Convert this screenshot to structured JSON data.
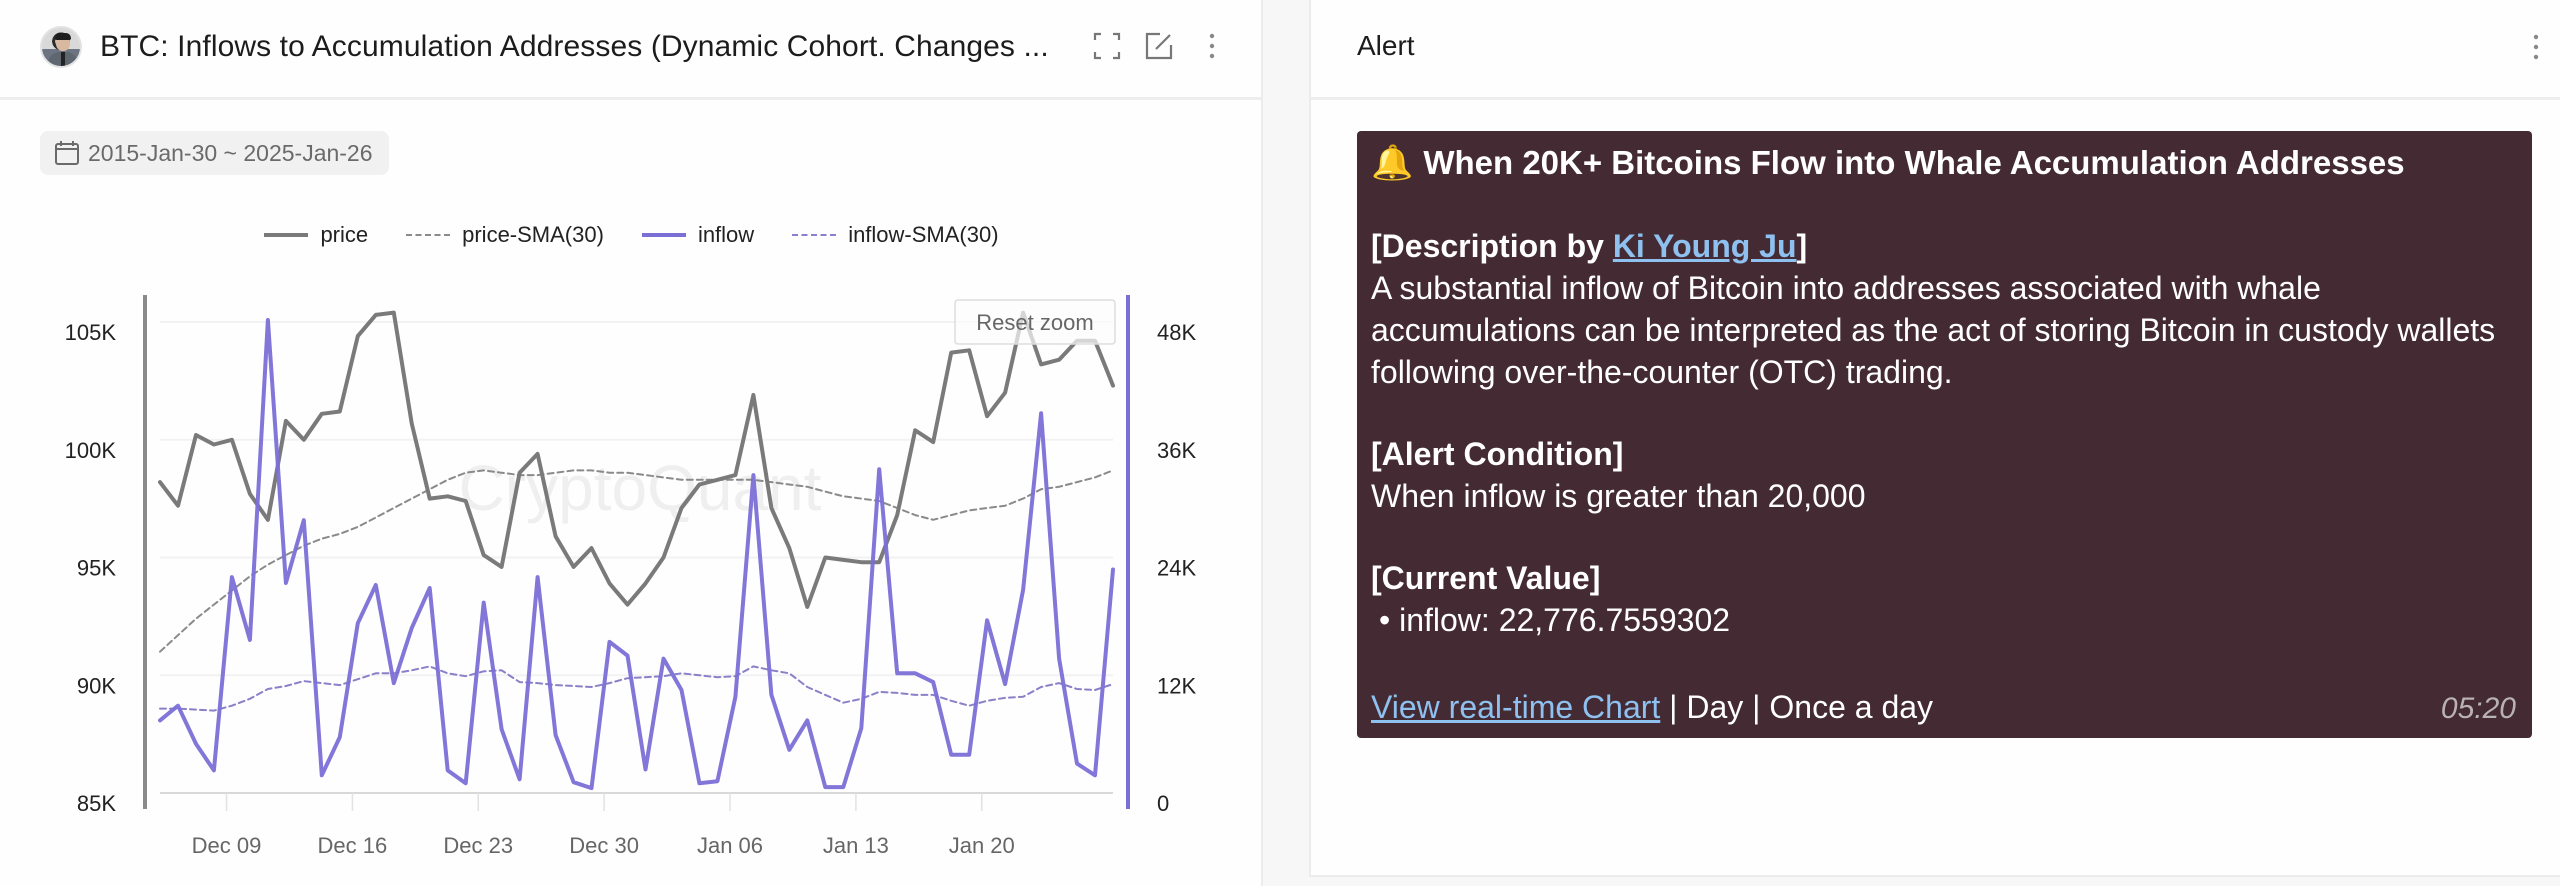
{
  "left_panel": {
    "title": "BTC: Inflows to Accumulation Addresses (Dynamic Cohort. Changes ...",
    "icons": {
      "fullscreen": "fullscreen-icon",
      "open_external": "open-external-icon",
      "more": "more-vertical-icon"
    },
    "date_range": "2015-Jan-30 ~ 2025-Jan-26",
    "reset_zoom_label": "Reset zoom",
    "watermark": "CryptoQuant"
  },
  "right_panel": {
    "title": "Alert",
    "more_icon": "more-vertical-icon",
    "alert": {
      "bell_icon": "🔔",
      "headline": "When 20K+ Bitcoins Flow into Whale Accumulation Addresses",
      "description_prefix": "[Description by ",
      "author_link": "Ki Young Ju",
      "description_suffix": "]",
      "description": "A substantial inflow of Bitcoin into addresses associated with whale accumulations can be interpreted as the act of storing Bitcoin in custody wallets following over-the-counter (OTC) trading.",
      "condition_heading": "[Alert Condition]",
      "condition": "When inflow is greater than 20,000",
      "current_heading": "[Current Value]",
      "current_value": "• inflow: 22,776.7559302",
      "chart_link": "View real-time Chart",
      "sep1": " | ",
      "interval": "Day",
      "sep2": " | ",
      "frequency": "Once a day",
      "time": "05:20"
    }
  },
  "colors": {
    "price": "#7a7a7a",
    "inflow": "#7b6fd6",
    "alert_bg": "#442b33",
    "link": "#8ec0f0"
  },
  "chart_data": {
    "type": "line",
    "title": "BTC: Inflows to Accumulation Addresses (Dynamic Cohort. Changes ...",
    "legend": [
      "price",
      "price-SMA(30)",
      "inflow",
      "inflow-SMA(30)"
    ],
    "legend_position": "top-center",
    "x_start": "2024-12-05",
    "x_interval": "1 day",
    "x_tick_labels": [
      "Dec 09",
      "Dec 16",
      "Dec 23",
      "Dec 30",
      "Jan 06",
      "Jan 13",
      "Jan 20"
    ],
    "x_tick_offsets_days": [
      4,
      11,
      18,
      25,
      32,
      39,
      46
    ],
    "y_left": {
      "label": "price",
      "ticks": [
        "85K",
        "90K",
        "95K",
        "100K",
        "105K"
      ],
      "range": [
        85000,
        105000
      ]
    },
    "y_right": {
      "label": "inflow",
      "ticks": [
        "0",
        "12K",
        "24K",
        "36K",
        "48K"
      ],
      "range": [
        0,
        48000
      ]
    },
    "grid": true,
    "series": [
      {
        "name": "price",
        "axis": "left",
        "style": "solid",
        "values": [
          98200,
          97200,
          100200,
          99800,
          100000,
          97700,
          96600,
          100800,
          100000,
          101100,
          101200,
          104400,
          105300,
          105400,
          100700,
          97500,
          97600,
          97400,
          95100,
          94600,
          98600,
          99400,
          95900,
          94600,
          95400,
          93900,
          93000,
          93900,
          95000,
          97100,
          98100,
          98300,
          98500,
          101900,
          97100,
          95400,
          92900,
          95000,
          94900,
          94800,
          94800,
          96800,
          100400,
          99900,
          103700,
          103800,
          101000,
          102000,
          105400,
          103200,
          103400,
          104200,
          104200,
          102300
        ]
      },
      {
        "name": "price-SMA(30)",
        "axis": "left",
        "style": "dashed",
        "values": [
          91000,
          91700,
          92400,
          93000,
          93600,
          94200,
          94700,
          95100,
          95500,
          95800,
          96000,
          96300,
          96700,
          97100,
          97500,
          97900,
          98300,
          98600,
          98700,
          98600,
          98500,
          98500,
          98600,
          98700,
          98700,
          98600,
          98600,
          98500,
          98400,
          98300,
          98300,
          98300,
          98300,
          98300,
          98200,
          98100,
          98000,
          97800,
          97600,
          97500,
          97400,
          97100,
          96800,
          96600,
          96800,
          97000,
          97100,
          97200,
          97500,
          97900,
          98000,
          98200,
          98400,
          98700
        ]
      },
      {
        "name": "inflow",
        "axis": "right",
        "style": "solid",
        "values": [
          7400,
          8900,
          5000,
          2300,
          22000,
          15600,
          48200,
          21400,
          27800,
          1800,
          5700,
          17300,
          21200,
          11200,
          16800,
          20900,
          2300,
          1000,
          19400,
          6500,
          1400,
          22000,
          5900,
          1100,
          500,
          15400,
          14000,
          2400,
          13700,
          10500,
          1000,
          1200,
          9800,
          32400,
          10000,
          4400,
          7400,
          600,
          600,
          6600,
          33000,
          12200,
          12200,
          11300,
          3900,
          3900,
          17600,
          11100,
          20700,
          38700,
          13700,
          3000,
          1800,
          22777
        ]
      },
      {
        "name": "inflow-SMA(30)",
        "axis": "right",
        "style": "dashed",
        "values": [
          8600,
          8600,
          8500,
          8400,
          8900,
          9600,
          10600,
          10900,
          11400,
          11200,
          11000,
          11600,
          12200,
          12200,
          12500,
          12900,
          12200,
          11900,
          12400,
          12500,
          11300,
          11200,
          11000,
          10900,
          10800,
          11200,
          11700,
          11800,
          11900,
          12200,
          12000,
          11800,
          11900,
          12900,
          12500,
          12200,
          10800,
          10000,
          9200,
          9600,
          10300,
          10200,
          10000,
          10000,
          9400,
          8900,
          9400,
          9700,
          9800,
          10800,
          11200,
          10600,
          10500,
          11100
        ]
      }
    ]
  }
}
